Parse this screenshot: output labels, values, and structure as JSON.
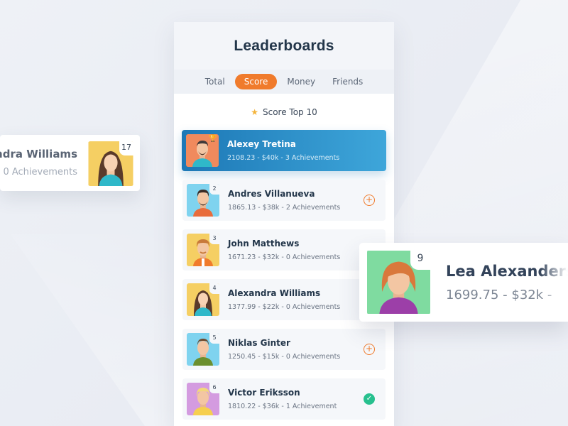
{
  "header": {
    "title": "Leaderboards"
  },
  "tabs": [
    {
      "label": "Total"
    },
    {
      "label": "Score"
    },
    {
      "label": "Money"
    },
    {
      "label": "Friends"
    }
  ],
  "subtitle": {
    "icon": "star-icon",
    "text": "Score Top 10"
  },
  "rows": [
    {
      "rank": "",
      "name": "Alexey Tretina",
      "stats": "2108.23  -  $40k  -  3 Achievements",
      "avatar_bg": "#f08a5d",
      "action": ""
    },
    {
      "rank": "2",
      "name": "Andres Villanueva",
      "stats": "1865.13  -  $38k  -  2 Achievements",
      "avatar_bg": "#7fd3ef",
      "action": "plus"
    },
    {
      "rank": "3",
      "name": "John Matthews",
      "stats": "1671.23  -  $32k  -  0 Achievements",
      "avatar_bg": "#f5cf63",
      "action": ""
    },
    {
      "rank": "4",
      "name": "Alexandra Williams",
      "stats": "1377.99  -  $22k  -  0 Achievements",
      "avatar_bg": "#f5cf63",
      "action": ""
    },
    {
      "rank": "5",
      "name": "Niklas Ginter",
      "stats": "1250.45  -  $15k  -  0 Achievements",
      "avatar_bg": "#7fd3ef",
      "action": "plus"
    },
    {
      "rank": "6",
      "name": "Victor Eriksson",
      "stats": "1810.22  -  $36k  -  1 Achievement",
      "avatar_bg": "#d49be0",
      "action": "check"
    }
  ],
  "float_left": {
    "name": "andra Williams",
    "stats": "0 Achievements",
    "rank": "17"
  },
  "float_right": {
    "name": "Lea Alexanderss",
    "stats": "1699.75  -  $32k  -",
    "rank": "9"
  },
  "colors": {
    "accent": "#f07b2c",
    "first_row_start": "#1d78b6",
    "first_row_end": "#3ea6da",
    "success": "#27c08e",
    "star": "#f4b33a"
  }
}
